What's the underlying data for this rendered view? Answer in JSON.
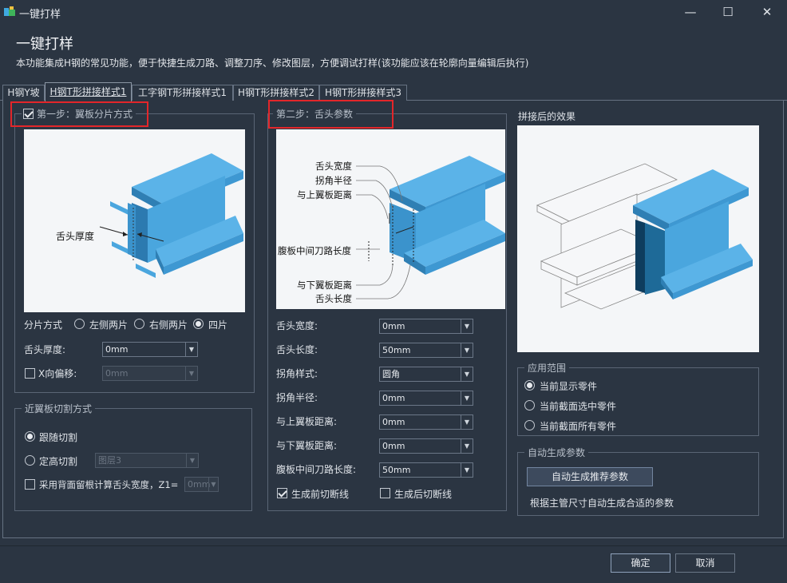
{
  "window": {
    "title": "一键打样",
    "controls": {
      "minimize": "—",
      "maximize": "☐",
      "close": "✕"
    }
  },
  "header": {
    "title": "一键打样",
    "description": "本功能集成H钢的常见功能，便于快捷生成刀路、调整刀序、修改图层，方便调试打样(该功能应该在轮廓向量编辑后执行)"
  },
  "tabs": [
    {
      "label": "H钢Y坡"
    },
    {
      "label": "H钢T形拼接样式1",
      "active": true
    },
    {
      "label": "工字钢T形拼接样式1"
    },
    {
      "label": "H钢T形拼接样式2"
    },
    {
      "label": "H钢T形拼接样式3"
    }
  ],
  "step1": {
    "legend": "第一步：翼板分片方式",
    "checked": true,
    "diagram_label": "舌头厚度",
    "split_label": "分片方式",
    "split_options": [
      {
        "label": "左侧两片",
        "selected": false
      },
      {
        "label": "右侧两片",
        "selected": false
      },
      {
        "label": "四片",
        "selected": true
      }
    ],
    "tongue_thickness_label": "舌头厚度:",
    "tongue_thickness_value": "0mm",
    "x_offset_label": "X向偏移:",
    "x_offset_checked": false,
    "x_offset_value": "0mm"
  },
  "near_flange": {
    "legend": "近翼板切割方式",
    "options": [
      {
        "label": "跟随切割",
        "selected": true
      },
      {
        "label": "定高切割",
        "selected": false
      }
    ],
    "layer_value": "图层3",
    "back_label": "采用背面留根计算舌头宽度，Z1=",
    "back_checked": false,
    "z1_value": "0mm"
  },
  "step2": {
    "legend": "第二步：舌头参数",
    "diagram_labels": [
      "舌头宽度",
      "拐角半径",
      "与上翼板距离",
      "腹板中间刀路长度",
      "与下翼板距离",
      "舌头长度"
    ],
    "params": [
      {
        "label": "舌头宽度:",
        "value": "0mm"
      },
      {
        "label": "舌头长度:",
        "value": "50mm"
      },
      {
        "label": "拐角样式:",
        "value": "圆角"
      },
      {
        "label": "拐角半径:",
        "value": "0mm"
      },
      {
        "label": "与上翼板距离:",
        "value": "0mm"
      },
      {
        "label": "与下翼板距离:",
        "value": "0mm"
      },
      {
        "label": "腹板中间刀路长度:",
        "value": "50mm"
      }
    ],
    "pre_cut_label": "生成前切断线",
    "pre_cut_checked": true,
    "post_cut_label": "生成后切断线",
    "post_cut_checked": false
  },
  "result": {
    "label": "拼接后的效果"
  },
  "scope": {
    "legend": "应用范围",
    "options": [
      {
        "label": "当前显示零件",
        "selected": true
      },
      {
        "label": "当前截面选中零件",
        "selected": false
      },
      {
        "label": "当前截面所有零件",
        "selected": false
      }
    ]
  },
  "auto": {
    "legend": "自动生成参数",
    "button_label": "自动生成推荐参数",
    "hint": "根据主管尺寸自动生成合适的参数"
  },
  "footer": {
    "ok_label": "确定",
    "cancel_label": "取消"
  },
  "colors": {
    "background": "#2b3542",
    "steel": "#4fa9e0",
    "steel_dark": "#2f7fb4",
    "highlight": "#e3262a"
  }
}
